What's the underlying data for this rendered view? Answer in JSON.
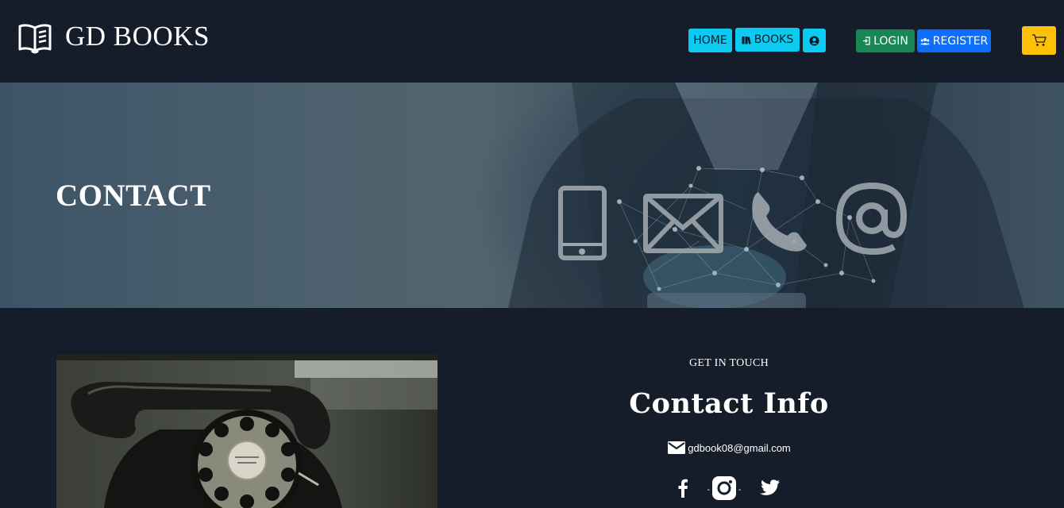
{
  "brand": {
    "name": "GD BOOKS",
    "icon": "open-book-icon"
  },
  "nav": {
    "home": "HOME",
    "books": "BOOKS",
    "books_icon": "books-icon",
    "profile_icon": "user-circle-icon",
    "login": "LOGIN",
    "login_icon": "login-icon",
    "register": "REGISTER",
    "register_icon": "users-icon",
    "cart_icon": "cart-icon"
  },
  "hero": {
    "title": "CONTACT"
  },
  "contact": {
    "eyebrow": "GET IN TOUCH",
    "title": "Contact Info",
    "email": "gdbook08@gmail.com",
    "socials": [
      "facebook-icon",
      "instagram-icon",
      "twitter-icon"
    ],
    "separator": "-"
  },
  "colors": {
    "background": "#161d2a",
    "cyan": "#0dcaf0",
    "green": "#198754",
    "blue": "#0d6efd",
    "yellow": "#ffc107"
  }
}
